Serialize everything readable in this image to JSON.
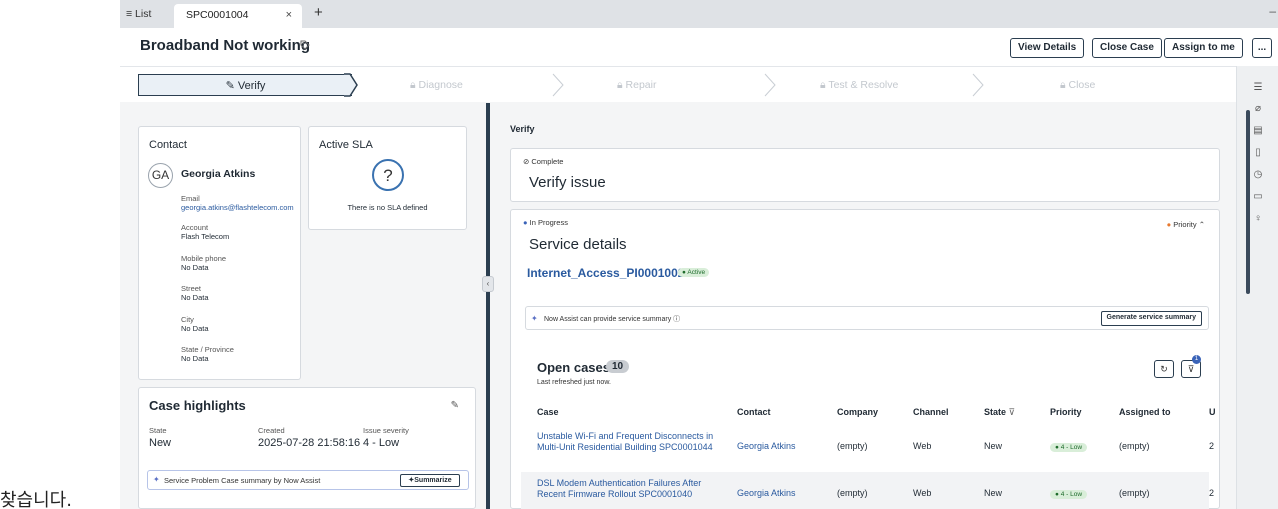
{
  "caption": "찾습니다.",
  "tabs": {
    "list_label": "≡ List",
    "active_label": "SPC0001004",
    "close_glyph": "×",
    "add_glyph": "+",
    "dash_glyph": "–"
  },
  "header": {
    "title": "Broadband Not working",
    "buttons": {
      "view_details": "View Details",
      "close_case": "Close Case",
      "assign_to_me": "Assign to me",
      "more": "..."
    }
  },
  "stages": {
    "active": "Verify",
    "items": [
      "Diagnose",
      "Repair",
      "Test & Resolve",
      "Close"
    ]
  },
  "contact": {
    "title": "Contact",
    "initials": "GA",
    "name": "Georgia Atkins",
    "fields": [
      {
        "label": "Email",
        "value": "georgia.atkins@flashtelecom.com"
      },
      {
        "label": "Account",
        "value": "Flash Telecom"
      },
      {
        "label": "Mobile phone",
        "value": "No Data"
      },
      {
        "label": "Street",
        "value": "No Data"
      },
      {
        "label": "City",
        "value": "No Data"
      },
      {
        "label": "State / Province",
        "value": "No Data"
      }
    ]
  },
  "sla": {
    "title": "Active SLA",
    "empty_text": "There is no SLA defined"
  },
  "highlights": {
    "title": "Case highlights",
    "state_label": "State",
    "state_value": "New",
    "created_label": "Created",
    "created_value": "2025-07-28 21:58:16",
    "severity_label": "Issue severity",
    "severity_value": "4 - Low",
    "now_assist_text": "Service Problem Case summary by Now Assist",
    "summarize_label": "Summarize"
  },
  "main": {
    "section_title": "Verify",
    "verify_card": {
      "status": "Complete",
      "title": "Verify issue"
    },
    "service_card": {
      "status": "In Progress",
      "priority_label": "Priority",
      "title": "Service details",
      "service_link": "Internet_Access_PI0001002",
      "service_status": "Active",
      "now_assist_text": "Now Assist can provide service summary",
      "generate_label": "Generate service summary"
    },
    "open_cases": {
      "title": "Open cases",
      "count": "10",
      "subtitle": "Last refreshed just now.",
      "filter_count": "1",
      "columns": [
        "Case",
        "Contact",
        "Company",
        "Channel",
        "State",
        "Priority",
        "Assigned to",
        "U"
      ],
      "rows": [
        {
          "case": "Unstable Wi-Fi and Frequent Disconnects in Multi-Unit Residential Building SPC0001044",
          "contact": "Georgia Atkins",
          "company": "(empty)",
          "channel": "Web",
          "state": "New",
          "priority": "4 - Low",
          "assigned": "(empty)",
          "u": "2"
        },
        {
          "case": "DSL Modem Authentication Failures After Recent Firmware Rollout SPC0001040",
          "contact": "Georgia Atkins",
          "company": "(empty)",
          "channel": "Web",
          "state": "New",
          "priority": "4 - Low",
          "assigned": "(empty)",
          "u": "2"
        }
      ]
    }
  },
  "colors": {
    "accent": "#2b3e50",
    "link": "#2a5a9f",
    "priority_dot": "#e8792f",
    "active_badge": "#d9eed9",
    "overlay": "#5fc48a"
  }
}
